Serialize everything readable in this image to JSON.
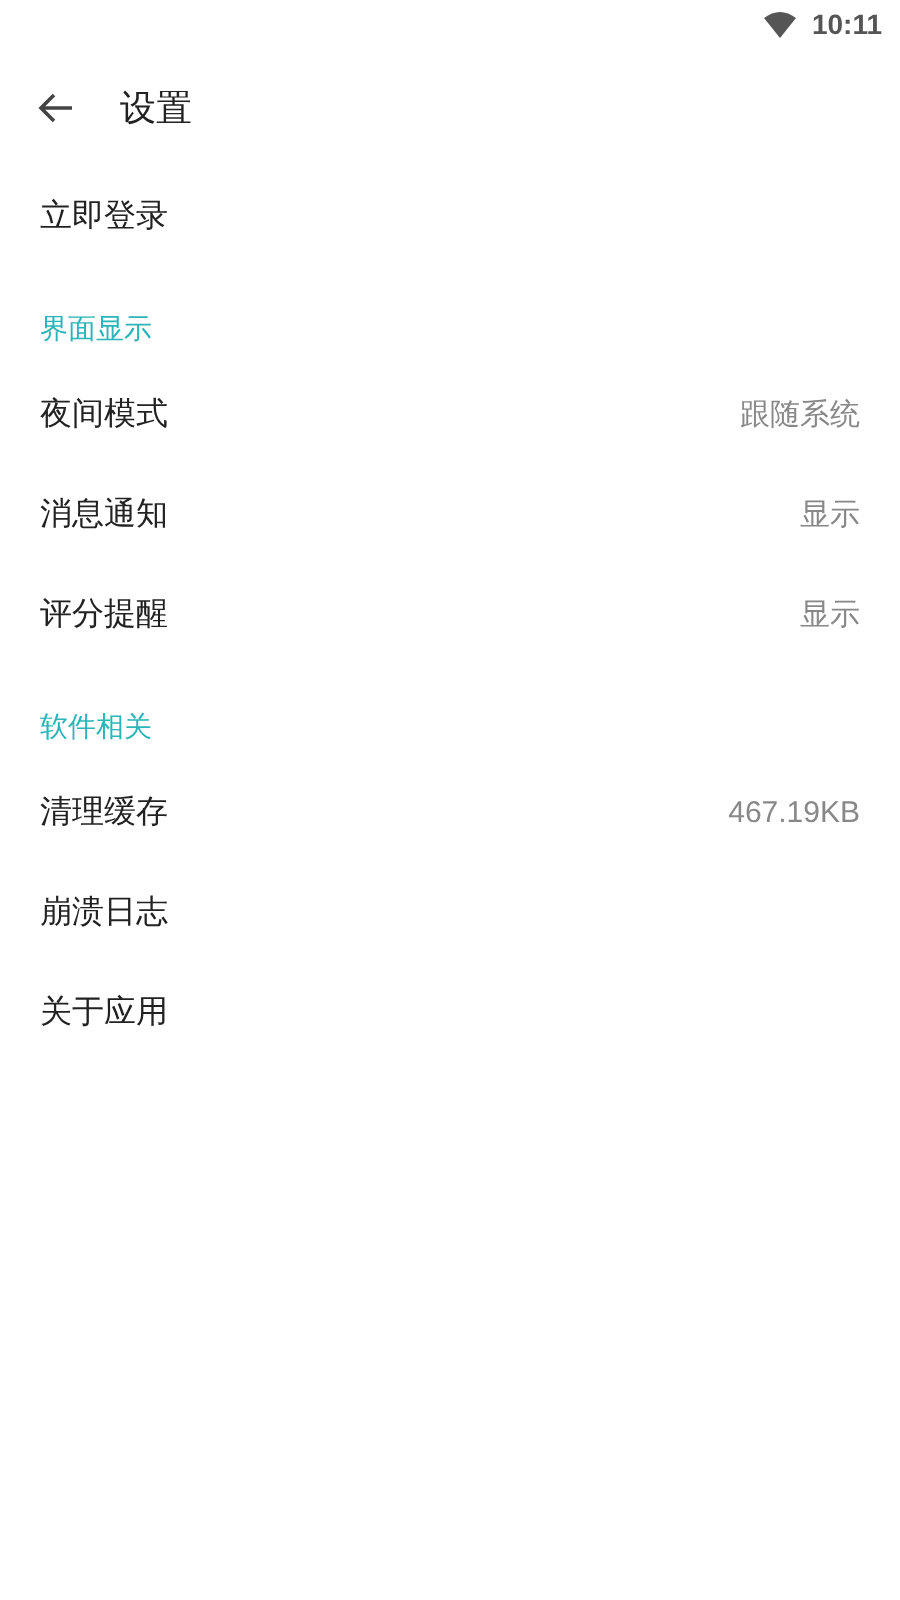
{
  "status_bar": {
    "time": "10:11"
  },
  "toolbar": {
    "title": "设置"
  },
  "items": [
    {
      "kind": "row",
      "label": "立即登录"
    },
    {
      "kind": "header",
      "label": "界面显示"
    },
    {
      "kind": "row",
      "label": "夜间模式",
      "value": "跟随系统"
    },
    {
      "kind": "row",
      "label": "消息通知",
      "value": "显示"
    },
    {
      "kind": "row",
      "label": "评分提醒",
      "value": "显示"
    },
    {
      "kind": "header",
      "label": "软件相关"
    },
    {
      "kind": "row",
      "label": "清理缓存",
      "value": "467.19KB"
    },
    {
      "kind": "row",
      "label": "崩溃日志"
    },
    {
      "kind": "row",
      "label": "关于应用"
    }
  ]
}
